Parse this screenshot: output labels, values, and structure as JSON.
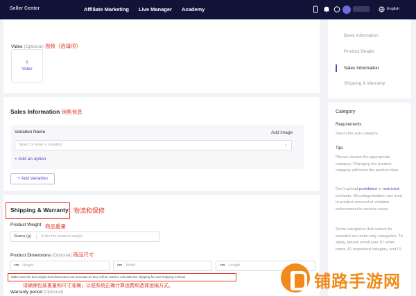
{
  "nav": {
    "logo": "Seller Center",
    "links": [
      "Affiliate Marketing",
      "Live Manager",
      "Academy"
    ],
    "language": "English",
    "icons": [
      "phone-icon",
      "bell-icon",
      "help-icon",
      "avatar"
    ]
  },
  "video": {
    "label": "Video",
    "optional": "(Optional)",
    "annotation": "视频（选填项）",
    "upload_plus": "+",
    "upload_label": "Video"
  },
  "sales": {
    "title": "Sales Information",
    "annotation": "销售信息",
    "variation_name_label": "Variation Name",
    "add_image": "Add image",
    "select_placeholder": "Select or enter a variation",
    "add_option": "+ Add an option",
    "add_variation": "+ Add Variation"
  },
  "shipping": {
    "title": "Shipping & Warranty",
    "annotation": "物流和保修",
    "weight_label": "Product Weight",
    "weight_annotation": "商品重量",
    "weight_unit": "Grams (g)",
    "weight_placeholder": "Enter the product weight",
    "dimensions_label": "Product Dimensions",
    "dimensions_optional": "(Optional)",
    "dimensions_annotation": "商品尺寸",
    "dim_unit": "cm",
    "height_placeholder": "Height",
    "width_placeholder": "Width",
    "length_placeholder": "Length",
    "notice": "Make sure the box weight and dimensions are accurate as they will be used to calculate the shipping fee and shipping method.",
    "notice_annotation": "请确保包装重量和尺寸准确，以便系统正确计算运费和选择运输方式。",
    "warranty_label": "Warranty period",
    "warranty_optional": "(Optional)"
  },
  "right_nav": {
    "items": [
      "Basic information",
      "Product Details",
      "Sales Information",
      "Shipping & Warranty"
    ],
    "active_index": 2
  },
  "category_help": {
    "title": "Category",
    "requirements_label": "Requirements",
    "requirements_text": "Select the sub-category.",
    "tips_label": "Tips",
    "tip1": "Please choose the appropriate category. Changing the product category will reset the product data.",
    "tip2_a": "Don't upload",
    "tip2_prohibited": "prohibited",
    "tip2_or": "or",
    "tip2_restricted": "restricted",
    "tip2_b": "products. Miscategorisation may lead to product removal or violation enforcement in serious cases.",
    "tip3": "Some categories that cannot be selected are invite-only categories. To apply, please email your ID seller name, ID requested category, and ID"
  },
  "watermark": "铺路手游网",
  "colors": {
    "nav_bg": "#121339",
    "accent": "#4a4ad0",
    "annotation": "#e33a2b",
    "watermark": "#f18a1b"
  }
}
